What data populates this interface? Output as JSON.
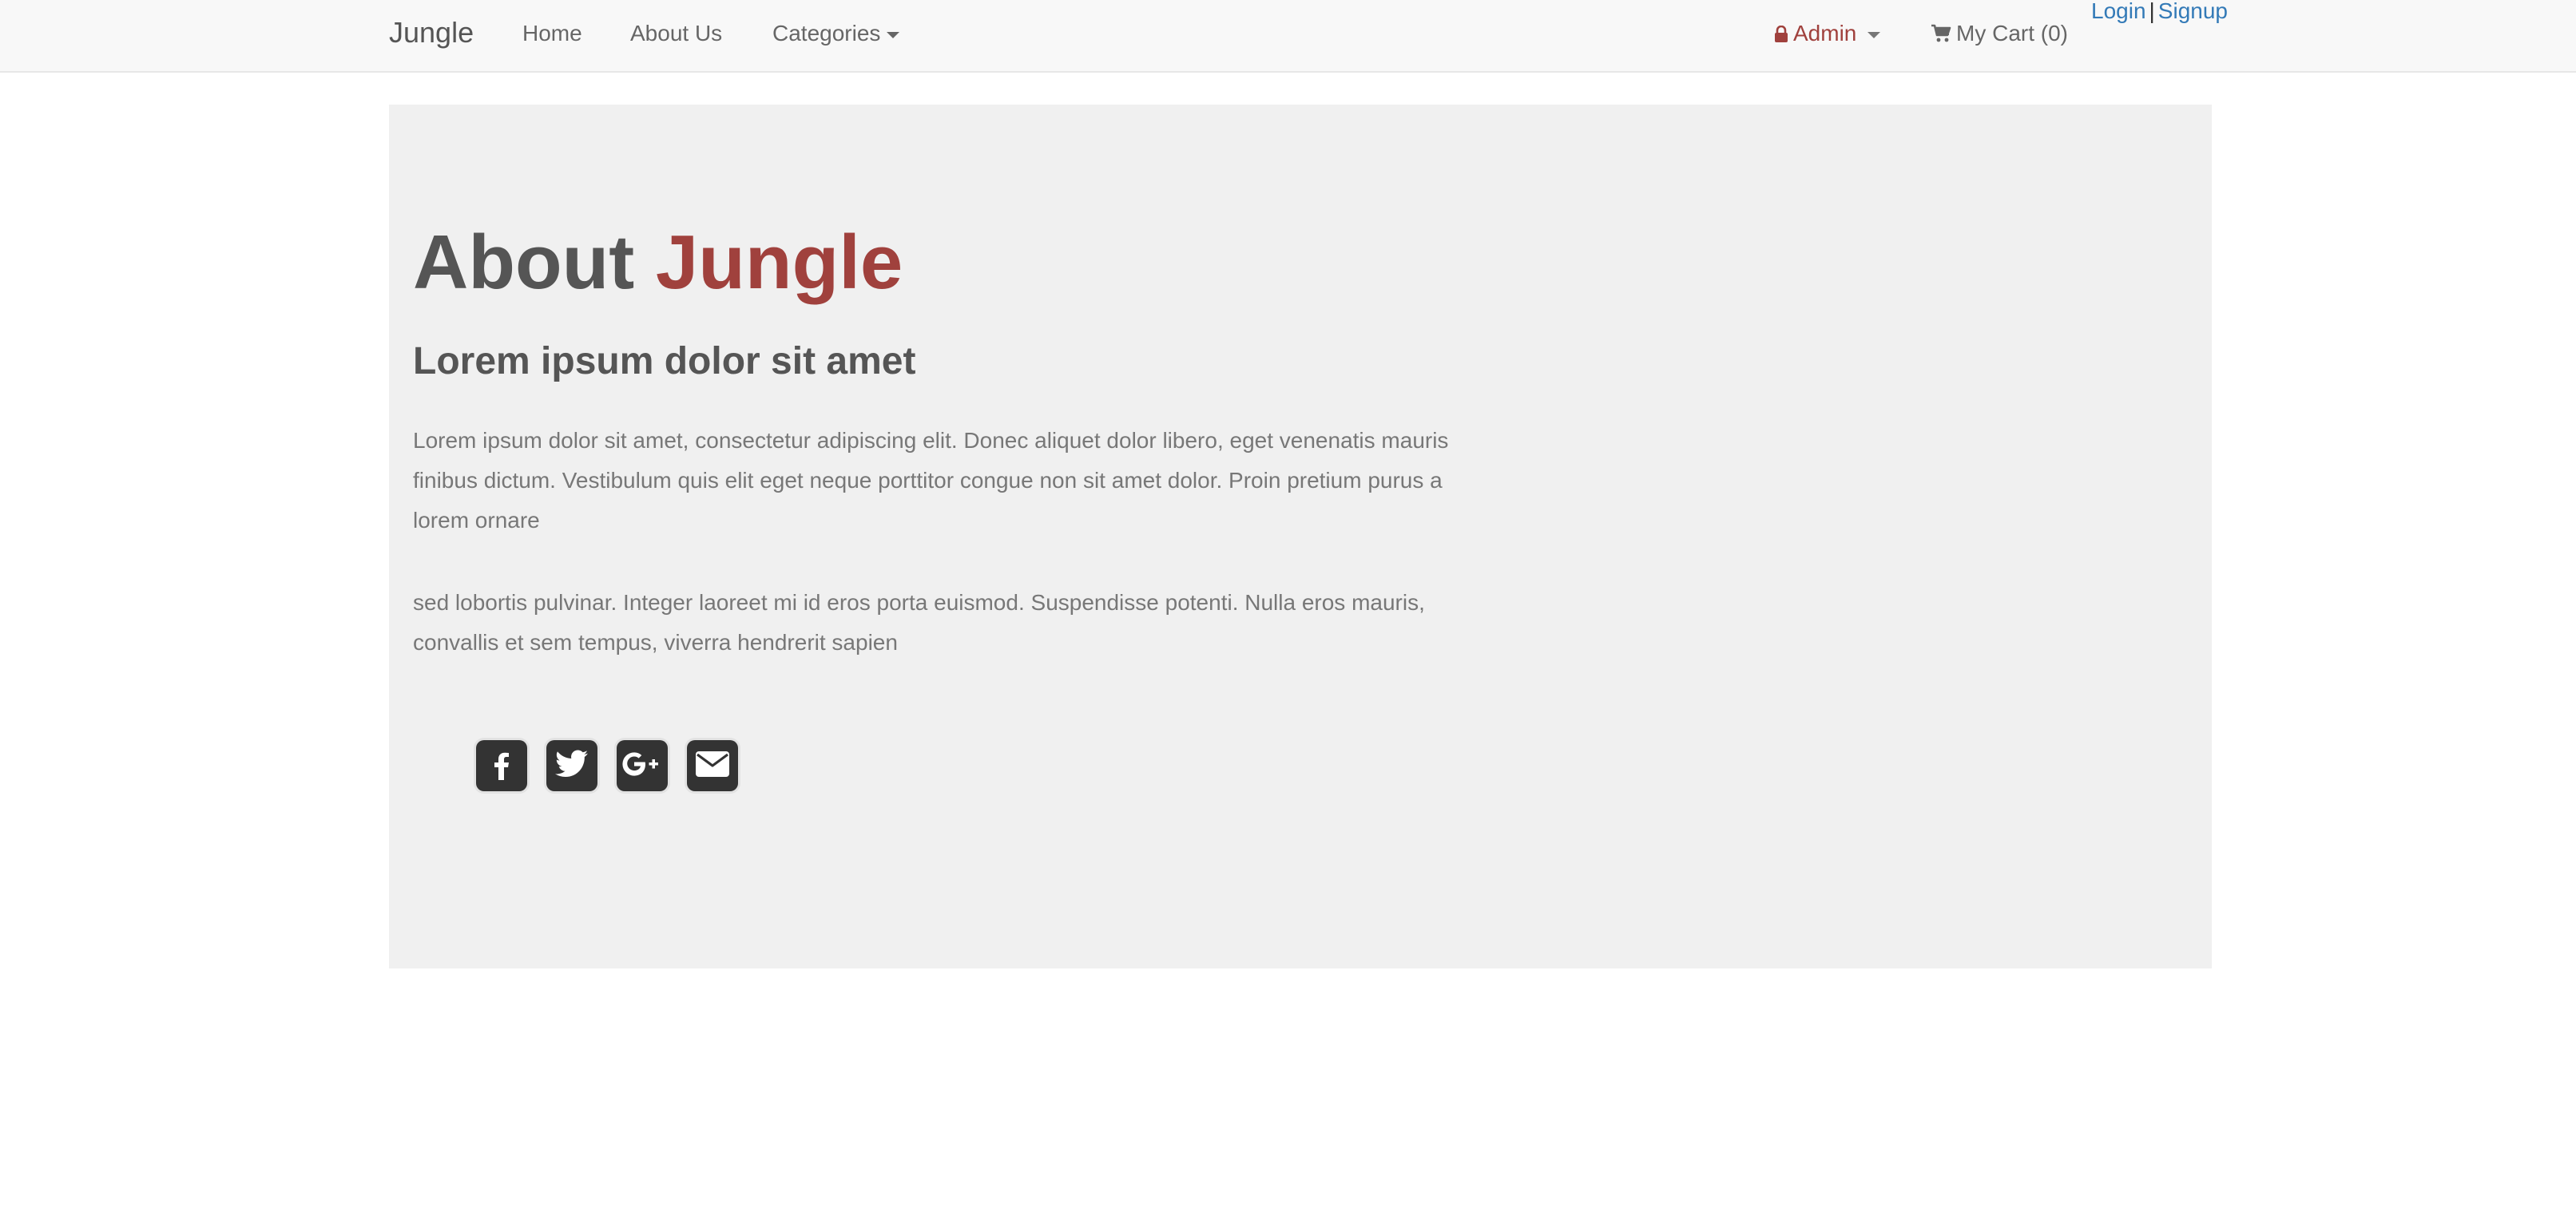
{
  "navbar": {
    "brand": "Jungle",
    "links": [
      "Home",
      "About Us",
      "Categories"
    ],
    "admin_label": "Admin",
    "cart_label": "My Cart (0)",
    "login_label": "Login",
    "separator": "|",
    "signup_label": "Signup"
  },
  "page": {
    "title_prefix": "About",
    "title_accent": "Jungle",
    "subtitle": "Lorem ipsum dolor sit amet",
    "paragraphs": [
      "Lorem ipsum dolor sit amet, consectetur adipiscing elit. Donec aliquet dolor libero, eget venenatis mauris finibus dictum. Vestibulum quis elit eget neque porttitor congue non sit amet dolor. Proin pretium purus a lorem ornare",
      "sed lobortis pulvinar. Integer laoreet mi id eros porta euismod. Suspendisse potenti. Nulla eros mauris, convallis et sem tempus, viverra hendrerit sapien"
    ]
  },
  "social_icons": [
    "facebook-icon",
    "twitter-icon",
    "google-plus-icon",
    "envelope-icon"
  ],
  "colors": {
    "accent": "#a0413d",
    "link": "#337ab7",
    "navbar_bg": "#f8f8f8",
    "jumbotron_bg": "#f0f0f0",
    "icon_bg": "#333333"
  }
}
